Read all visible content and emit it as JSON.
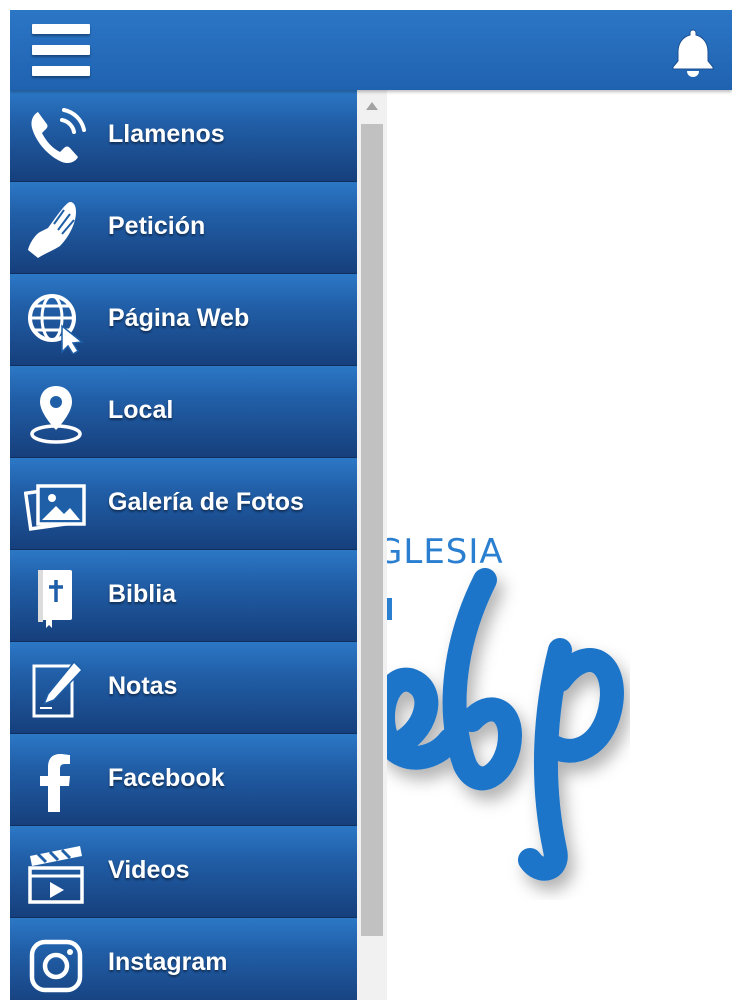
{
  "header": {
    "menu_icon": "hamburger-menu-icon",
    "notification_icon": "bell-icon",
    "bar_color": "#2568b8"
  },
  "logo": {
    "word": "IGLESIA",
    "script": "ebp",
    "color": "#2a7fd0"
  },
  "drawer": {
    "items": [
      {
        "label": "Llamenos",
        "icon": "phone-icon"
      },
      {
        "label": "Petición",
        "icon": "praying-hands-icon"
      },
      {
        "label": "Página Web",
        "icon": "globe-cursor-icon"
      },
      {
        "label": "Local",
        "icon": "location-pin-icon"
      },
      {
        "label": "Galería de Fotos",
        "icon": "photo-gallery-icon"
      },
      {
        "label": "Biblia",
        "icon": "bible-icon"
      },
      {
        "label": "Notas",
        "icon": "notes-pencil-icon"
      },
      {
        "label": "Facebook",
        "icon": "facebook-icon"
      },
      {
        "label": "Videos",
        "icon": "video-clapper-icon"
      },
      {
        "label": "Instagram",
        "icon": "instagram-icon"
      }
    ]
  }
}
